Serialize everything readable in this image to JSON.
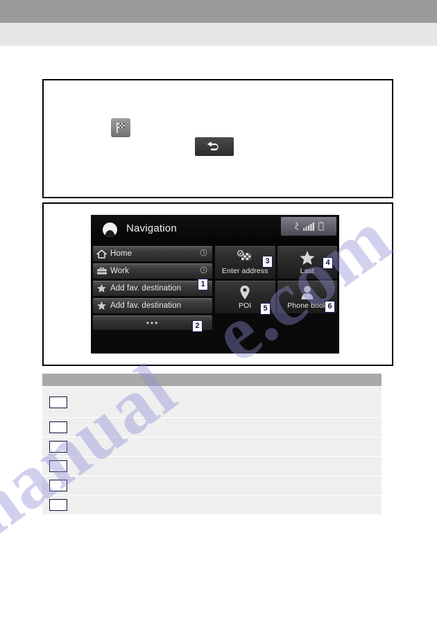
{
  "page": {
    "watermark_left": "manual",
    "watermark_right": "e.com"
  },
  "figure_top": {
    "flag_button_icon": "checkered-flag-icon",
    "back_button_icon": "back-arrow-icon"
  },
  "nav_screen": {
    "logo_icon": "navigation-compass-icon",
    "title": "Navigation",
    "status": {
      "bluetooth_icon": "bluetooth-icon",
      "signal_icon": "signal-bars-icon",
      "battery_icon": "battery-icon"
    },
    "list": [
      {
        "label": "Home",
        "icon": "home-icon",
        "trailing_icon": "clock-icon"
      },
      {
        "label": "Work",
        "icon": "briefcase-icon",
        "trailing_icon": "clock-icon"
      },
      {
        "label": "Add fav. destination",
        "icon": "star-icon",
        "trailing_icon": ""
      },
      {
        "label": "Add fav. destination",
        "icon": "star-icon",
        "trailing_icon": ""
      }
    ],
    "more_row": {
      "label": "•••",
      "icon": "ellipsis-icon"
    },
    "tiles": [
      {
        "label": "Enter address",
        "icon": "checkered-flag-address-icon"
      },
      {
        "label": "Last",
        "icon": "star-icon"
      },
      {
        "label": "POI",
        "icon": "map-pin-icon"
      },
      {
        "label": "Phone book",
        "icon": "contact-person-icon"
      }
    ],
    "callouts": [
      "1",
      "2",
      "3",
      "4",
      "5",
      "6"
    ]
  },
  "table": {
    "headers": [
      "",
      "",
      ""
    ],
    "rows": [
      {
        "num": "",
        "desc": "",
        "ref": ""
      },
      {
        "num": "",
        "desc": "",
        "ref": ""
      },
      {
        "num": "",
        "desc": "",
        "ref": ""
      },
      {
        "num": "",
        "desc": "",
        "ref": ""
      },
      {
        "num": "",
        "desc": "",
        "ref": ""
      },
      {
        "num": "",
        "desc": "",
        "ref": ""
      }
    ]
  }
}
